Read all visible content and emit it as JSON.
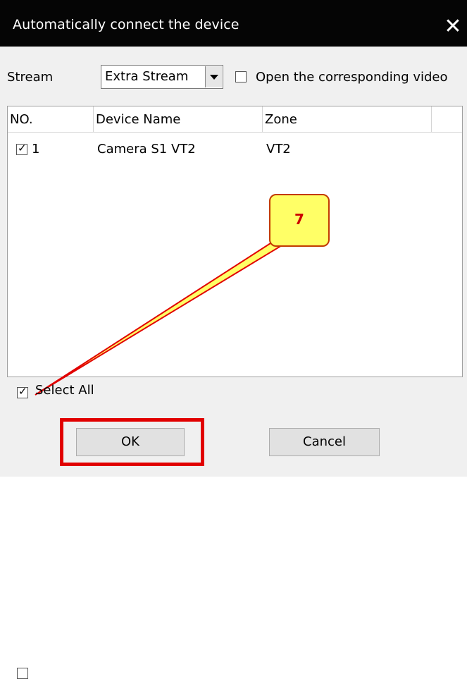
{
  "dialog": {
    "title": "Automatically connect the device",
    "close_icon": "close-icon"
  },
  "stream": {
    "label": "Stream",
    "selected": "Extra Stream",
    "open_video_label": "Open the corresponding video",
    "open_video_checked": false
  },
  "device_list": {
    "columns": [
      "NO.",
      "Device Name",
      "Zone",
      ""
    ],
    "rows": [
      {
        "no": "1",
        "device_name": "Camera S1 VT2",
        "zone": "VT2",
        "checked": true
      }
    ]
  },
  "select_all": {
    "label": "Select All",
    "checked": true
  },
  "buttons": {
    "ok": "OK",
    "cancel": "Cancel"
  },
  "annotation": {
    "callout_number": "7",
    "accent_color": "#e10000",
    "callout_fill": "#ffff66"
  }
}
